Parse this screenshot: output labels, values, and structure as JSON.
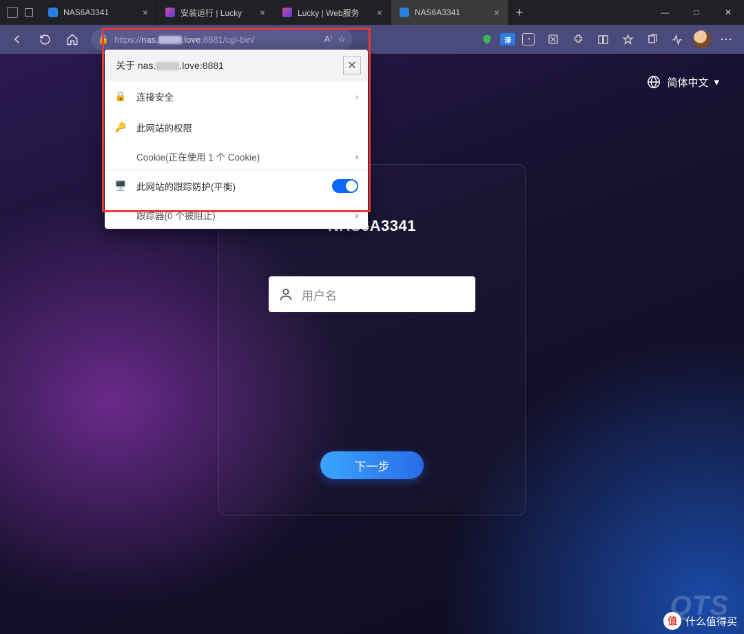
{
  "window": {
    "minimize": "—",
    "maximize": "□",
    "close": "✕"
  },
  "tabs": [
    {
      "label": "NAS6A3341",
      "active": false,
      "favicon": "#2a7de1"
    },
    {
      "label": "安装运行 | Lucky",
      "active": false,
      "favicon": "#b34ad1"
    },
    {
      "label": "Lucky | Web服务",
      "active": false,
      "favicon": "#b34ad1"
    },
    {
      "label": "NAS6A3341",
      "active": true,
      "favicon": "#2a7de1"
    }
  ],
  "address": {
    "scheme": "https://",
    "host_pre": "nas.",
    "host_post": ".love",
    "port": ":8881",
    "path": "/cgi-bin/"
  },
  "popup": {
    "title_pre": "关于 nas.",
    "title_post": ".love:8881",
    "secure": "连接安全",
    "permissions": "此网站的权限",
    "cookies": "Cookie(正在使用 1 个 Cookie)",
    "tracking": "此网站的跟踪防护(平衡)",
    "trackers": "跟踪器(0 个被阻止)"
  },
  "page": {
    "language": "简体中文",
    "login_title": "NAS6A3341",
    "username_placeholder": "用户名",
    "next_button": "下一步",
    "brand": "QTS"
  },
  "watermark": {
    "badge": "值",
    "text": "什么值得买"
  }
}
